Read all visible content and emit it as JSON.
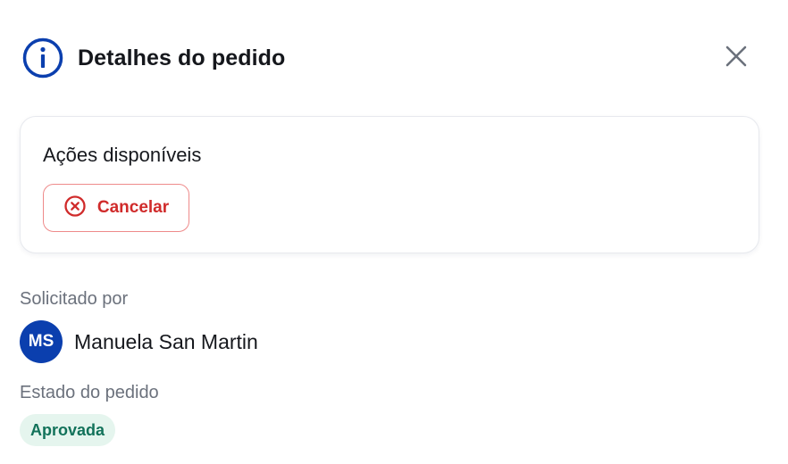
{
  "header": {
    "title": "Detalhes do pedido",
    "info_icon": "info-icon",
    "close_icon": "close-icon"
  },
  "actions": {
    "title": "Ações disponíveis",
    "cancel_label": "Cancelar",
    "cancel_icon": "x-circle-icon"
  },
  "requested_by": {
    "label": "Solicitado por",
    "initials": "MS",
    "name": "Manuela San Martin"
  },
  "order_status": {
    "label": "Estado do pedido",
    "value": "Aprovada"
  },
  "colors": {
    "info_icon": "#0b3fae",
    "avatar_bg": "#0b3fae",
    "cancel_red": "#d02b2b",
    "cancel_border": "#ee8a8a",
    "status_bg": "#e5f5ee",
    "status_text": "#12725a"
  }
}
